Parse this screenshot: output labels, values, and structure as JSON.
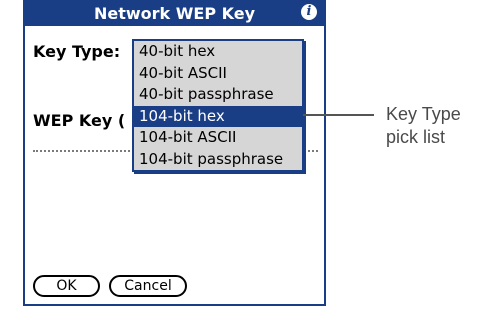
{
  "dialog": {
    "title": "Network WEP Key",
    "info_icon": "i",
    "key_type_label": "Key Type:",
    "wep_key_label": "WEP Key (",
    "buttons": {
      "ok": "OK",
      "cancel": "Cancel"
    }
  },
  "picklist": {
    "selected_index": 3,
    "items": [
      "40-bit hex",
      "40-bit ASCII",
      "40-bit passphrase",
      "104-bit hex",
      "104-bit ASCII",
      "104-bit passphrase"
    ]
  },
  "callout": {
    "line1": "Key Type",
    "line2": "pick list"
  },
  "colors": {
    "title_bar": "#1a3e85",
    "picklist_background": "#d6d6d6",
    "selection": "#1a3e85"
  }
}
